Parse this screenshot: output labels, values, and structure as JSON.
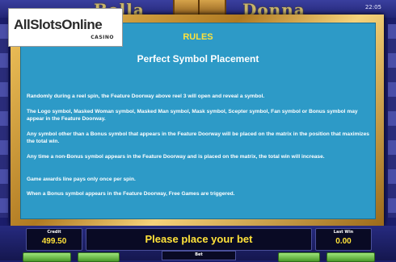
{
  "header": {
    "deco_left": "Bella",
    "deco_right": "Donna",
    "clock": "22:05"
  },
  "logo": {
    "main": "AllSlotsOnline",
    "sub": "CASINO"
  },
  "rules": {
    "title": "RULES",
    "subtitle": "Perfect Symbol Placement",
    "paragraphs": [
      "Randomly during a reel spin, the Feature Doorway above reel 3 will open and reveal a symbol.",
      "The Logo symbol, Masked Woman symbol, Masked Man symbol, Mask symbol, Scepter symbol, Fan symbol or Bonus symbol may appear in the Feature Doorway.",
      "Any symbol other than a Bonus symbol that appears in the Feature Doorway will be placed on the matrix in the position that maximizes the total win.",
      "Any time a non-Bonus symbol appears in the Feature Doorway and is placed on the matrix, the total win will increase.",
      "Game awards line pays only once per spin.",
      "When a Bonus symbol appears in the Feature Doorway, Free Games are triggered."
    ]
  },
  "bottom": {
    "credit_label": "Credit",
    "credit_value": "499.50",
    "message": "Please place your bet",
    "lastwin_label": "Last Win",
    "lastwin_value": "0.00",
    "bet_label": "Bet"
  }
}
